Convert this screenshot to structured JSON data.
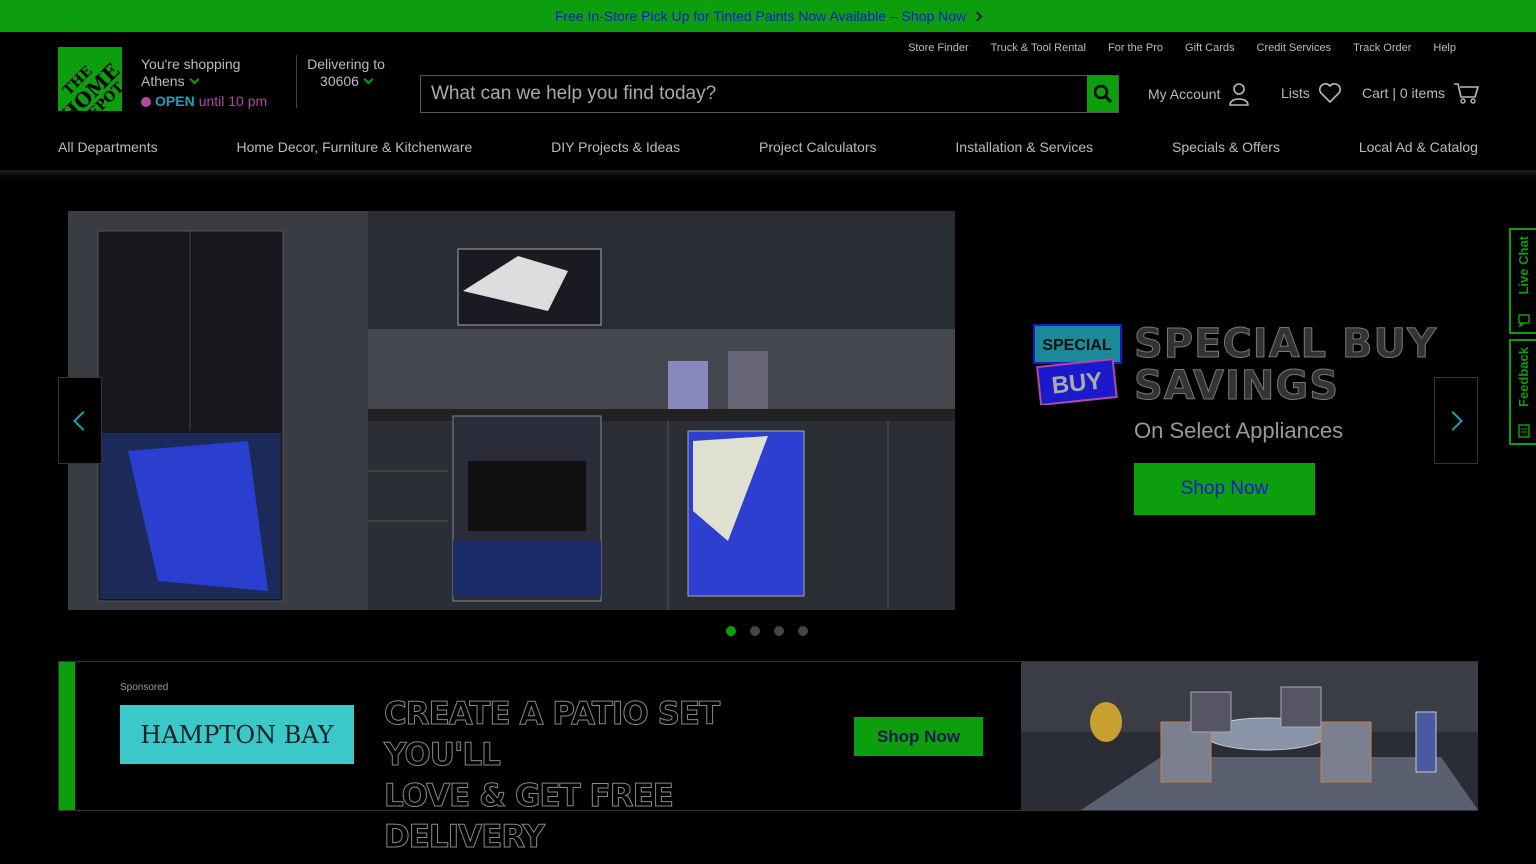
{
  "promo": {
    "text": "Free In-Store Pick Up for Tinted Paints Now Available – Shop Now"
  },
  "logo": {
    "line1": "THE",
    "line2": "HOME",
    "line3": "DEPOT"
  },
  "store": {
    "shopping_label": "You're shopping",
    "city": "Athens",
    "status": "OPEN",
    "hours": "until 10 pm"
  },
  "delivery": {
    "label": "Delivering to",
    "zip": "30606"
  },
  "utility_links": [
    "Store Finder",
    "Truck & Tool Rental",
    "For the Pro",
    "Gift Cards",
    "Credit Services",
    "Track Order",
    "Help"
  ],
  "search": {
    "placeholder": "What can we help you find today?"
  },
  "account": {
    "my_account": "My Account",
    "lists": "Lists",
    "cart": "Cart | 0 items"
  },
  "nav": [
    "All Departments",
    "Home Decor, Furniture & Kitchenware",
    "DIY Projects & Ideas",
    "Project Calculators",
    "Installation & Services",
    "Specials & Offers",
    "Local Ad & Catalog"
  ],
  "hero": {
    "badge_top": "SPECIAL",
    "badge_bottom": "BUY",
    "title_line1": "SPECIAL BUY",
    "title_line2": "SAVINGS",
    "subtitle": "On Select Appliances",
    "cta": "Shop Now",
    "slide_count": 4,
    "active_slide": 1
  },
  "side_tabs": {
    "live_chat": "Live Chat",
    "feedback": "Feedback"
  },
  "sponsored": {
    "tag": "Sponsored",
    "brand": "HAMPTON BAY",
    "headline_line1": "CREATE A PATIO SET YOU'LL",
    "headline_line2": "LOVE & GET FREE DELIVERY",
    "cta": "Shop Now"
  },
  "colors": {
    "brand_green": "#0d9e0d",
    "link_blue": "#1a1acc",
    "teal": "#1aa3b8"
  }
}
